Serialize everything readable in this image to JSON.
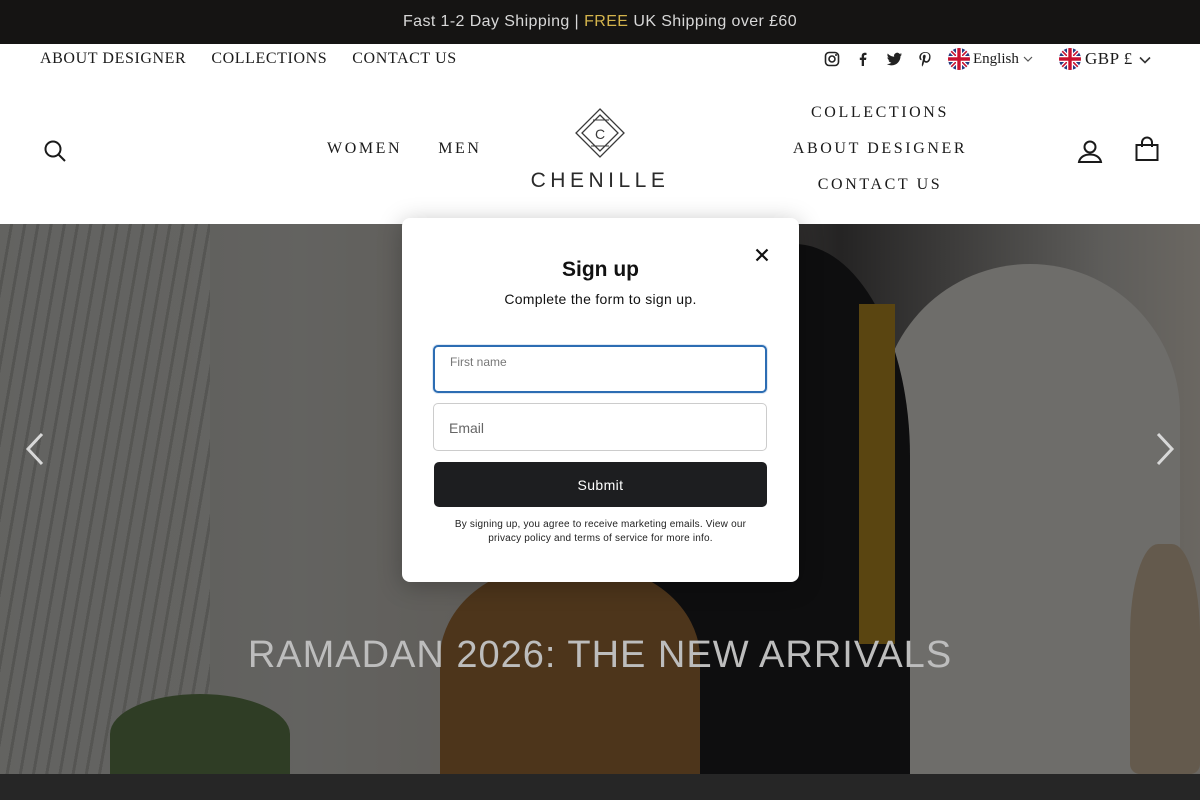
{
  "announcement": {
    "prefix": "Fast 1-2 Day Shipping |",
    "highlight": "FREE",
    "suffix": "UK Shipping over £60",
    "highlight_color": "#d4b44c"
  },
  "utility_nav": {
    "links": [
      "ABOUT DESIGNER",
      "COLLECTIONS",
      "CONTACT US"
    ],
    "socials": [
      "instagram-icon",
      "facebook-icon",
      "twitter-icon",
      "pinterest-icon"
    ],
    "language": "English",
    "currency": "GBP £"
  },
  "header": {
    "logo_text": "CHENILLE",
    "logo_monogram": "C",
    "nav_left": [
      "WOMEN",
      "MEN"
    ],
    "nav_right": [
      "COLLECTIONS",
      "ABOUT DESIGNER",
      "CONTACT US"
    ],
    "icons": [
      "search-icon",
      "account-icon",
      "cart-icon"
    ]
  },
  "hero": {
    "title": "RAMADAN 2026: THE NEW ARRIVALS"
  },
  "modal": {
    "title": "Sign up",
    "subtitle": "Complete the form to sign up.",
    "first_name_label": "First name",
    "first_name_value": "",
    "email_placeholder": "Email",
    "submit_label": "Submit",
    "legal": "By signing up, you agree to receive marketing emails. View our privacy policy and terms of service for more info."
  }
}
